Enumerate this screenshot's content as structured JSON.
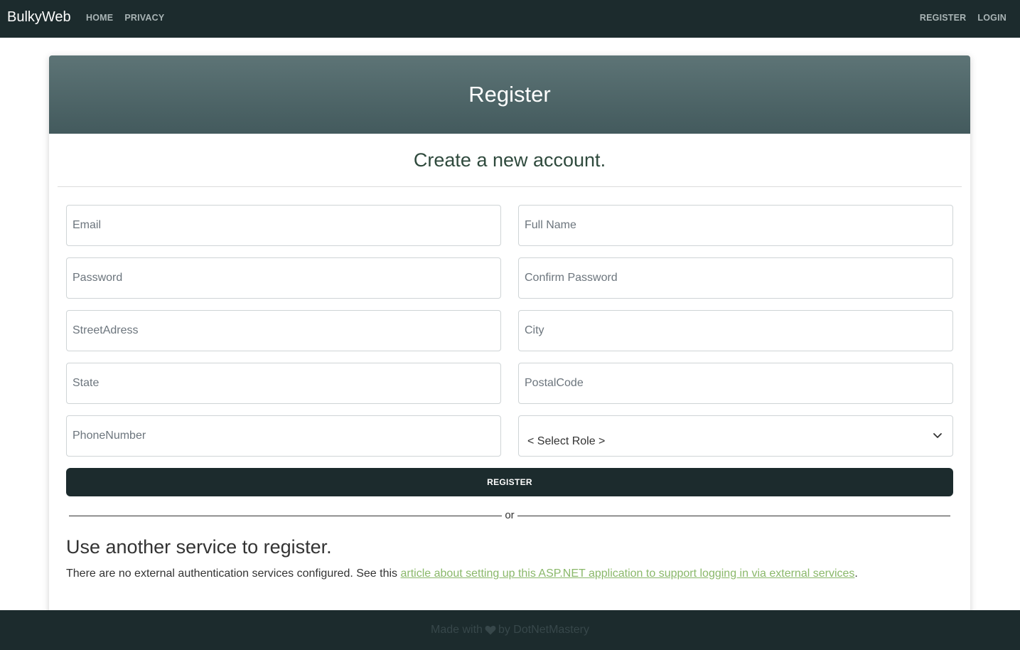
{
  "navbar": {
    "brand": "BulkyWeb",
    "left_links": [
      "HOME",
      "PRIVACY"
    ],
    "right_links": [
      "REGISTER",
      "LOGIN"
    ]
  },
  "card": {
    "header_title": "Register",
    "subtitle": "Create a new account."
  },
  "form": {
    "email_placeholder": "Email",
    "full_name_placeholder": "Full Name",
    "password_placeholder": "Password",
    "confirm_password_placeholder": "Confirm Password",
    "street_placeholder": "StreetAdress",
    "city_placeholder": "City",
    "state_placeholder": "State",
    "postal_placeholder": "PostalCode",
    "phone_placeholder": "PhoneNumber",
    "role_selected": "< Select Role >",
    "register_button": "REGISTER",
    "or_text": "or"
  },
  "external": {
    "heading": "Use another service to register.",
    "text_before": "There are no external authentication services configured. See this ",
    "link_text": "article about setting up this ASP.NET application to support logging in via external services",
    "text_after": "."
  },
  "footer": {
    "made_with": "Made with",
    "by_text": "by DotNetMastery",
    "heart_icon": "heart-icon"
  },
  "colors": {
    "navbar_bg": "#1c2b2d",
    "header_gradient_top": "#5d7476",
    "header_gradient_bottom": "#435a5d",
    "link_color": "#8ab86a"
  }
}
